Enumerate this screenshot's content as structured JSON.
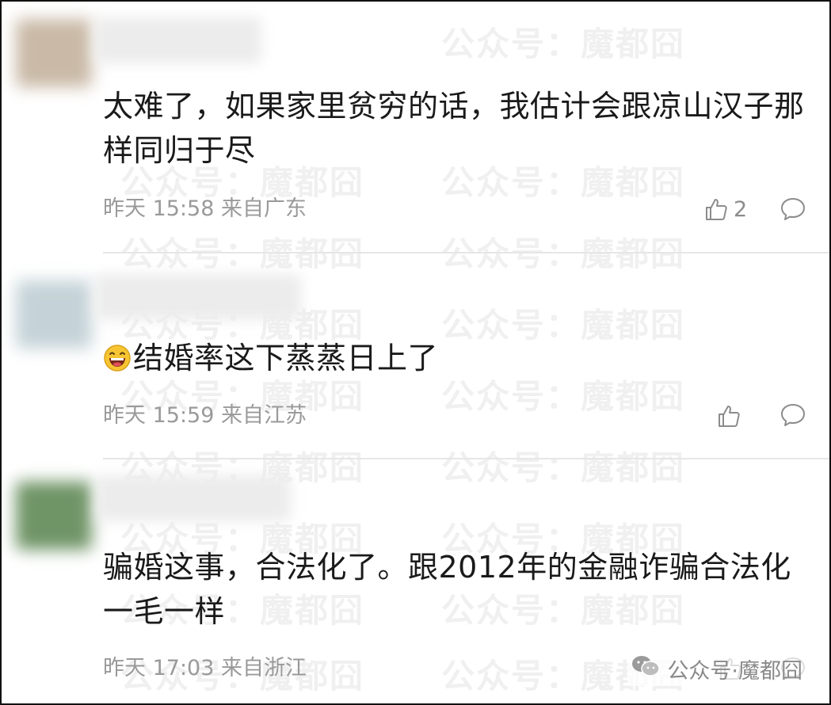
{
  "comments": [
    {
      "text": "太难了，如果家里贫穷的话，我估计会跟凉山汉子那样同归于尽",
      "meta": "昨天 15:58 来自广东",
      "likes": "2",
      "avatar_color": "#c9b9a6"
    },
    {
      "text": "结婚率这下蒸蒸日上了",
      "meta": "昨天 15:59 来自江苏",
      "likes": "",
      "avatar_color": "#c5d3d8"
    },
    {
      "text": "骗婚这事，合法化了。跟2012年的金融诈骗合法化一毛一样",
      "meta": "昨天 17:03 来自浙江",
      "likes": "",
      "avatar_color": "#6f9466"
    }
  ],
  "icons": {
    "like": "thumbs-up-icon",
    "reply": "comment-bubble-icon",
    "emoji": "laughing-emoji-icon",
    "wechat": "wechat-icon"
  },
  "watermark": {
    "text": "公众号：魔都囧",
    "footer": "公众号·魔都囧"
  },
  "colors": {
    "text": "#1a1a1a",
    "meta": "#9a9a9a",
    "divider": "#e6e6e6"
  }
}
